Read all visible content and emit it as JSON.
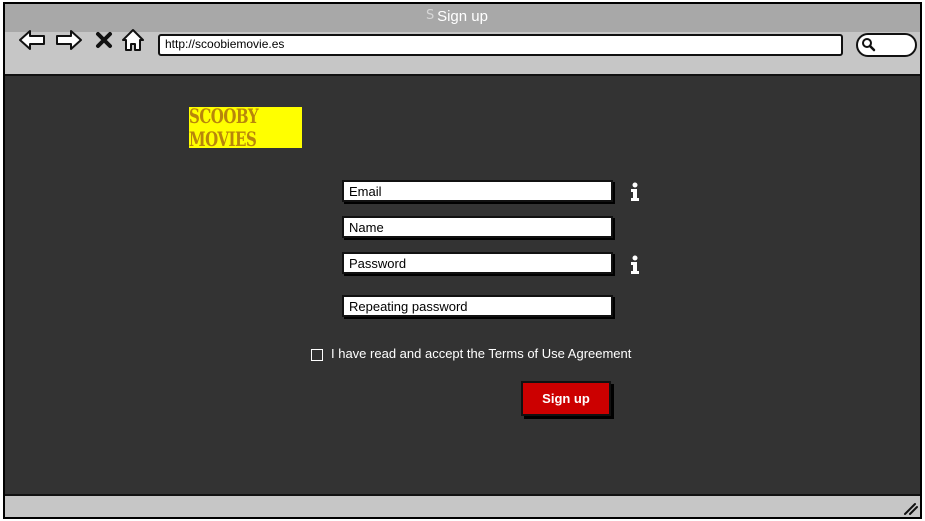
{
  "window": {
    "title": "Sign up",
    "title_ghost": "S"
  },
  "toolbar": {
    "back_icon": "back-arrow-icon",
    "forward_icon": "forward-arrow-icon",
    "stop_icon": "close-icon",
    "home_icon": "home-icon",
    "url": "http://scoobiemovie.es",
    "search_icon": "search-icon"
  },
  "logo": {
    "text": "SCOOBY MOVIES",
    "background": "#ffff00",
    "text_color": "#b8860b"
  },
  "form": {
    "fields": [
      {
        "label": "Email",
        "has_info": true
      },
      {
        "label": "Name",
        "has_info": false
      },
      {
        "label": "Password",
        "has_info": true
      },
      {
        "label": "Repeating password",
        "has_info": false
      }
    ],
    "terms_label": "I have read and accept the Terms of Use Agreement",
    "terms_checked": false,
    "submit_label": "Sign up",
    "submit_color": "#cc0000"
  },
  "colors": {
    "content_bg": "#333333",
    "chrome_bg": "#c6c6c6",
    "titlebar_bg": "#a8a8a8"
  }
}
